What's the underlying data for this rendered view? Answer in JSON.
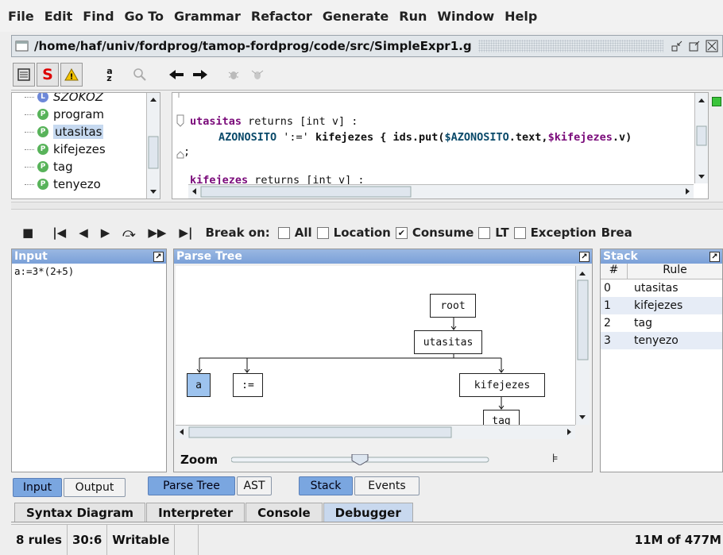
{
  "menu": [
    "File",
    "Edit",
    "Find",
    "Go To",
    "Grammar",
    "Refactor",
    "Generate",
    "Run",
    "Window",
    "Help"
  ],
  "window": {
    "title": "/home/haf/univ/fordprog/tamop-fordprog/code/src/SimpleExpr1.g"
  },
  "rules": [
    {
      "badge": "L",
      "name": "SZOKOZ"
    },
    {
      "badge": "P",
      "name": "program"
    },
    {
      "badge": "P",
      "name": "utasitas"
    },
    {
      "badge": "P",
      "name": "kifejezes"
    },
    {
      "badge": "P",
      "name": "tag"
    },
    {
      "badge": "P",
      "name": "tenyezo"
    }
  ],
  "editor": {
    "l1_a": "utasitas",
    "l1_b": " returns [int v] :",
    "l2_a": "AZONOSITO",
    "l2_b": " ':=' ",
    "l2_c": "kifejezes",
    "l2_d": " { ids.put(",
    "l2_e": "$AZONOSITO",
    "l2_f": ".text,",
    "l2_g": "$kifejezes",
    "l2_h": ".v)",
    "l3": ";",
    "l4_a": "kifejezes",
    "l4_b": " returns [int v] :"
  },
  "debugger": {
    "break_on": "Break on:",
    "options": [
      {
        "label": "All",
        "checked": false
      },
      {
        "label": "Location",
        "checked": false
      },
      {
        "label": "Consume",
        "checked": true
      },
      {
        "label": "LT",
        "checked": false
      },
      {
        "label": "Exception",
        "checked": false
      }
    ],
    "trailing": "Brea"
  },
  "input": {
    "header": "Input",
    "text": "a:=3*(2+5)"
  },
  "parse_tree": {
    "header": "Parse Tree",
    "nodes": {
      "root": "root",
      "utasitas": "utasitas",
      "a": "a",
      "assign": ":=",
      "kifejezes": "kifejezes",
      "tag": "tag"
    },
    "zoom_label": "Zoom",
    "zoom_value": 0.5
  },
  "stack": {
    "header": "Stack",
    "col_num": "#",
    "col_rule": "Rule",
    "rows": [
      {
        "n": "0",
        "rule": "utasitas"
      },
      {
        "n": "1",
        "rule": "kifejezes"
      },
      {
        "n": "2",
        "rule": "tag"
      },
      {
        "n": "3",
        "rule": "tenyezo"
      }
    ]
  },
  "view_buttons": {
    "input": "Input",
    "output": "Output",
    "parse_tree": "Parse Tree",
    "ast": "AST",
    "stack": "Stack",
    "events": "Events"
  },
  "tabs": [
    "Syntax Diagram",
    "Interpreter",
    "Console",
    "Debugger"
  ],
  "status": {
    "rules": "8 rules",
    "position": "30:6",
    "mode": "Writable",
    "memory": "11M of 477M"
  },
  "colors": {
    "selection": "#9dc3ee",
    "panel_header": "#7aa0d8",
    "keyword": "#7a0a7a"
  }
}
